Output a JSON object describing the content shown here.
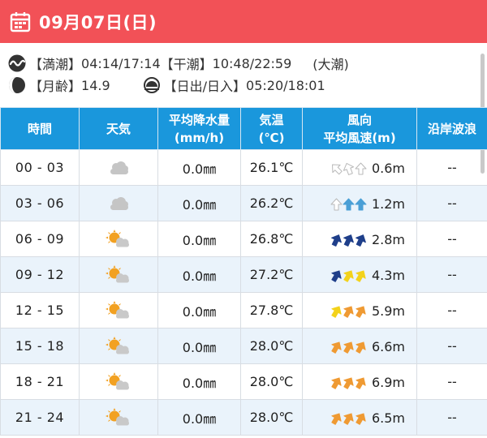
{
  "header": {
    "date": "09月07日(日)",
    "background": "#f25157"
  },
  "tide": {
    "high_label": "【満潮】",
    "high_times": "04:14/17:14",
    "low_label": "【干潮】",
    "low_times": "10:48/22:59",
    "tide_type": "(大潮)"
  },
  "moon": {
    "label": "【月齢】",
    "value": "14.9"
  },
  "sun": {
    "label": "【日出/日入】",
    "value": "05:20/18:01"
  },
  "table": {
    "header_color": "#1a97dc",
    "alt_row_color": "#eaf3fb",
    "columns": [
      {
        "line1": "時間",
        "line2": ""
      },
      {
        "line1": "天気",
        "line2": ""
      },
      {
        "line1": "平均降水量",
        "line2": "(mm/h)"
      },
      {
        "line1": "気温",
        "line2": "(℃)"
      },
      {
        "line1": "風向",
        "line2": "平均風速(m)"
      },
      {
        "line1": "沿岸波浪",
        "line2": ""
      }
    ],
    "rows": [
      {
        "time": "00 - 03",
        "weather": "cloudy",
        "precip": "0.0㎜",
        "temp": "26.1℃",
        "arrows": [
          "light",
          "light",
          "light"
        ],
        "dirs": [
          -45,
          -20,
          0
        ],
        "wind": "0.6m",
        "wave": "--"
      },
      {
        "time": "03 - 06",
        "weather": "cloudy",
        "precip": "0.0㎜",
        "temp": "26.2℃",
        "arrows": [
          "light",
          "blue",
          "blue"
        ],
        "dirs": [
          0,
          0,
          0
        ],
        "wind": "1.2m",
        "wave": "--"
      },
      {
        "time": "06 - 09",
        "weather": "partly-sunny",
        "precip": "0.0㎜",
        "temp": "26.8℃",
        "arrows": [
          "navy",
          "navy",
          "navy"
        ],
        "dirs": [
          25,
          25,
          25
        ],
        "wind": "2.8m",
        "wave": "--"
      },
      {
        "time": "09 - 12",
        "weather": "partly-sunny",
        "precip": "0.0㎜",
        "temp": "27.2℃",
        "arrows": [
          "navy",
          "yellow",
          "yellow"
        ],
        "dirs": [
          30,
          30,
          30
        ],
        "wind": "4.3m",
        "wave": "--"
      },
      {
        "time": "12 - 15",
        "weather": "partly-sunny",
        "precip": "0.0㎜",
        "temp": "27.8℃",
        "arrows": [
          "yellow",
          "orange",
          "orange"
        ],
        "dirs": [
          30,
          30,
          30
        ],
        "wind": "5.9m",
        "wave": "--"
      },
      {
        "time": "15 - 18",
        "weather": "partly-sunny",
        "precip": "0.0㎜",
        "temp": "28.0℃",
        "arrows": [
          "orange",
          "orange",
          "orange"
        ],
        "dirs": [
          30,
          30,
          30
        ],
        "wind": "6.6m",
        "wave": "--"
      },
      {
        "time": "18 - 21",
        "weather": "partly-sunny",
        "precip": "0.0㎜",
        "temp": "28.0℃",
        "arrows": [
          "orange",
          "orange",
          "orange"
        ],
        "dirs": [
          30,
          30,
          30
        ],
        "wind": "6.9m",
        "wave": "--"
      },
      {
        "time": "21 - 24",
        "weather": "partly-sunny",
        "precip": "0.0㎜",
        "temp": "28.0℃",
        "arrows": [
          "orange",
          "orange",
          "orange"
        ],
        "dirs": [
          30,
          30,
          30
        ],
        "wind": "6.5m",
        "wave": "--"
      }
    ]
  },
  "arrow_colors": {
    "light": "#dcdcdc",
    "blue": "#4a9fd6",
    "navy": "#1f3f8a",
    "yellow": "#f3d21b",
    "orange": "#ef9a33"
  },
  "icons": {
    "calendar": "calendar-icon",
    "tide": "wave-icon",
    "moon": "moon-icon",
    "sun": "sunrise-icon"
  }
}
